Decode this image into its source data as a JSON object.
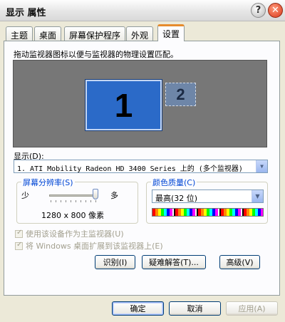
{
  "window": {
    "title": "显示 属性"
  },
  "titlebar": {
    "help_glyph": "?",
    "close_glyph": "✕"
  },
  "tabs": [
    {
      "label": "主题"
    },
    {
      "label": "桌面"
    },
    {
      "label": "屏幕保护程序"
    },
    {
      "label": "外观"
    },
    {
      "label": "设置",
      "active": true
    }
  ],
  "settings": {
    "instruction": "拖动监视器图标以便与监视器的物理设置匹配。",
    "monitor1_label": "1",
    "monitor2_label": "2",
    "display_label": "显示(D):",
    "display_value": "1. ATI Mobility Radeon HD 3400 Series 上的 (多个监视器)",
    "resolution": {
      "title": "屏幕分辨率(S)",
      "less_label": "少",
      "more_label": "多",
      "value": "1280 x 800 像素",
      "slider_fraction": 1.0
    },
    "color_quality": {
      "title": "颜色质量(C)",
      "value": "最高(32 位)"
    },
    "primary_monitor_label": "使用该设备作为主监视器(U)",
    "extend_desktop_label": "将 Windows 桌面扩展到该监视器上(E)",
    "identify_button": "识别(I)",
    "troubleshoot_button": "疑难解答(T)...",
    "advanced_button": "高级(V)"
  },
  "footer": {
    "ok_button": "确定",
    "cancel_button": "取消",
    "apply_button": "应用(A)"
  },
  "colors": {
    "accent_tab": "#e68b2c",
    "group_title": "#0046d5",
    "monitor_selected": "#2b6ac8"
  }
}
